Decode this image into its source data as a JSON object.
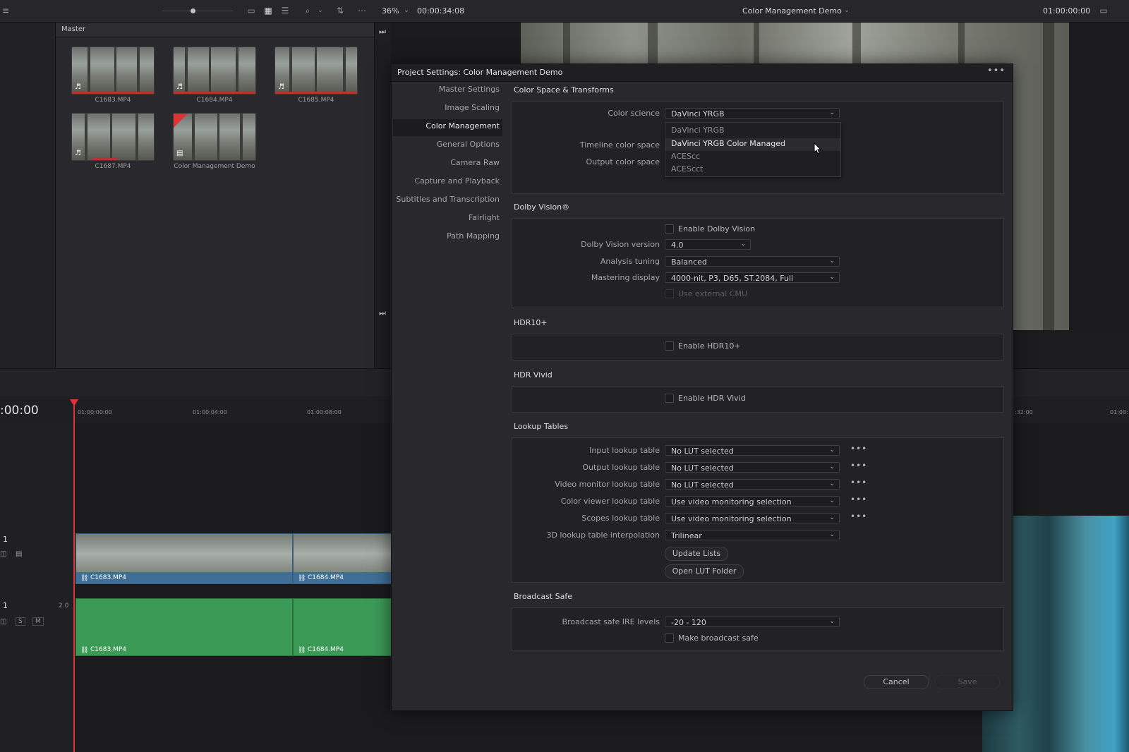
{
  "topbar": {
    "zoom": "36%",
    "timecode": "00:00:34:08",
    "project_title": "Color Management Demo",
    "record_timecode": "01:00:00:00"
  },
  "media_pool": {
    "bin": "Master",
    "clips": [
      {
        "name": "C1683.MP4"
      },
      {
        "name": "C1684.MP4"
      },
      {
        "name": "C1685.MP4"
      },
      {
        "name": "C1687.MP4"
      },
      {
        "name": "Color Management Demo"
      }
    ]
  },
  "timeline": {
    "current_timecode": ":00:00",
    "ruler": [
      "01:00:00:00",
      "01:00:04:00",
      "01:00:08:00",
      ":32:00",
      "01:00:"
    ],
    "video_track_number": "1",
    "audio_track_number": "1",
    "audio_channels": "2.0",
    "solo": "S",
    "mute": "M",
    "video_clips": [
      "C1683.MP4",
      "C1684.MP4"
    ],
    "audio_clips": [
      "C1683.MP4",
      "C1684.MP4"
    ]
  },
  "dialog": {
    "title": "Project Settings:  Color Management Demo",
    "nav": [
      "Master Settings",
      "Image Scaling",
      "Color Management",
      "General Options",
      "Camera Raw",
      "Capture and Playback",
      "Subtitles and Transcription",
      "Fairlight",
      "Path Mapping"
    ],
    "selected_nav": "Color Management",
    "color_space": {
      "title": "Color Space & Transforms",
      "color_science_label": "Color science",
      "color_science_value": "DaVinci YRGB",
      "timeline_cs_label": "Timeline color space",
      "output_cs_label": "Output color space",
      "menu_options": [
        "DaVinci YRGB",
        "DaVinci YRGB Color Managed",
        "ACEScc",
        "ACEScct"
      ],
      "menu_highlighted": "DaVinci YRGB Color Managed"
    },
    "dolby": {
      "title": "Dolby Vision®",
      "enable_label": "Enable Dolby Vision",
      "version_label": "Dolby Vision version",
      "version_value": "4.0",
      "tuning_label": "Analysis tuning",
      "tuning_value": "Balanced",
      "mastering_label": "Mastering display",
      "mastering_value": "4000-nit, P3, D65, ST.2084, Full",
      "external_cmu_label": "Use external CMU"
    },
    "hdr10": {
      "title": "HDR10+",
      "enable_label": "Enable HDR10+"
    },
    "hdr_vivid": {
      "title": "HDR Vivid",
      "enable_label": "Enable HDR Vivid"
    },
    "luts": {
      "title": "Lookup Tables",
      "rows": [
        {
          "label": "Input lookup table",
          "value": "No LUT selected"
        },
        {
          "label": "Output lookup table",
          "value": "No LUT selected"
        },
        {
          "label": "Video monitor lookup table",
          "value": "No LUT selected"
        },
        {
          "label": "Color viewer lookup table",
          "value": "Use video monitoring selection"
        },
        {
          "label": "Scopes lookup table",
          "value": "Use video monitoring selection"
        }
      ],
      "interp_label": "3D lookup table interpolation",
      "interp_value": "Trilinear",
      "update_button": "Update Lists",
      "open_folder_button": "Open LUT Folder",
      "more": "•••"
    },
    "broadcast": {
      "title": "Broadcast Safe",
      "ire_label": "Broadcast safe IRE levels",
      "ire_value": "-20 - 120",
      "make_safe_label": "Make broadcast safe"
    },
    "cancel": "Cancel",
    "save": "Save",
    "more_menu": "•••"
  }
}
